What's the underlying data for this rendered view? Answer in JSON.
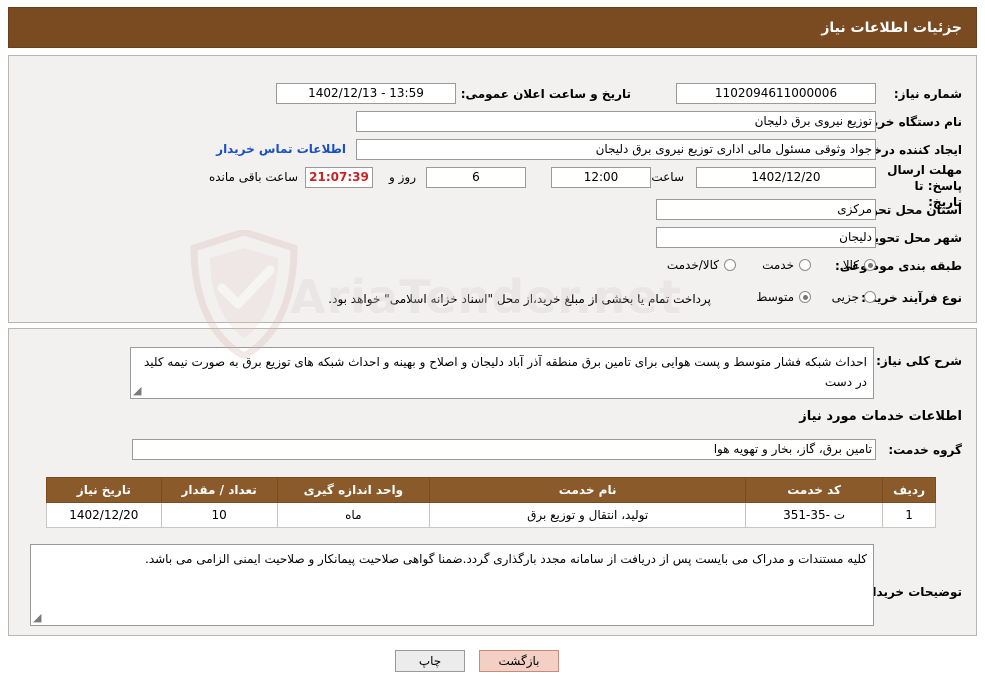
{
  "header": {
    "title": "جزئیات اطلاعات نیاز"
  },
  "form": {
    "need_number_label": "شماره نیاز:",
    "need_number_value": "1102094611000006",
    "public_announce_label": "تاریخ و ساعت اعلان عمومی:",
    "public_announce_value": "13:59 - 1402/12/13",
    "buyer_org_label": "نام دستگاه خریدار:",
    "buyer_org_value": "توزیع نیروی برق دلیجان",
    "creator_label": "ایجاد کننده درخواست:",
    "creator_value": "جواد وثوقی مسئول مالی اداری توزیع نیروی برق دلیجان",
    "contact_link": "اطلاعات تماس خریدار",
    "deadline_label": "مهلت ارسال پاسخ: تا تاریخ:",
    "deadline_date": "1402/12/20",
    "deadline_hour_label": "ساعت",
    "deadline_hour": "12:00",
    "remaining_days": "6",
    "remaining_days_label": "روز و",
    "remaining_time": "21:07:39",
    "remaining_suffix": "ساعت باقی مانده",
    "province_label": "استان محل تحویل:",
    "province_value": "مرکزی",
    "city_label": "شهر محل تحویل:",
    "city_value": "دلیجان",
    "category_label": "طبقه بندی موضوعی:",
    "category_options": [
      {
        "label": "کالا",
        "checked": true
      },
      {
        "label": "خدمت",
        "checked": false
      },
      {
        "label": "کالا/خدمت",
        "checked": false
      }
    ],
    "purchase_type_label": "نوع فرآیند خرید :",
    "purchase_type_options": [
      {
        "label": "جزیی",
        "checked": false
      },
      {
        "label": "متوسط",
        "checked": true
      }
    ],
    "purchase_note": "پرداخت تمام یا بخشی از مبلغ خرید،از محل \"اسناد خزانه اسلامی\" خواهد بود."
  },
  "details": {
    "general_desc_label": "شرح کلی نیاز:",
    "general_desc_value": "احداث شبکه فشار متوسط و پست هوایی برای تامین برق منطقه آذر آباد دلیجان و اصلاح و بهینه و احداث شبکه های توزیع برق به صورت نیمه کلید در دست",
    "services_section_title": "اطلاعات خدمات مورد نیاز",
    "service_group_label": "گروه خدمت:",
    "service_group_value": "تامین برق، گاز، بخار و تهویه هوا",
    "table": {
      "columns": [
        "ردیف",
        "کد خدمت",
        "نام خدمت",
        "واحد اندازه گیری",
        "تعداد / مقدار",
        "تاریخ نیاز"
      ],
      "rows": [
        [
          "1",
          "ت -35-351",
          "تولید، انتقال و توزیع برق",
          "ماه",
          "10",
          "1402/12/20"
        ]
      ]
    },
    "buyer_notes_label": "توضیحات خریدار:",
    "buyer_notes_value": "کلیه مستندات و مدراک می بایست پس از دریافت از سامانه مجدد بارگذاری گردد.ضمنا گواهی صلاحیت پیمانکار و صلاحیت ایمنی الزامی می باشد."
  },
  "footer": {
    "print_button": "چاپ",
    "back_button": "بازگشت"
  },
  "watermark": {
    "text": "AriaTender.net"
  },
  "colors": {
    "header_bg": "#7a4a21",
    "panel_bg": "#f2f1f0",
    "table_header_bg": "#8a5a2b",
    "link": "#1a4fc4",
    "back_button_bg": "#f3cfc4"
  }
}
